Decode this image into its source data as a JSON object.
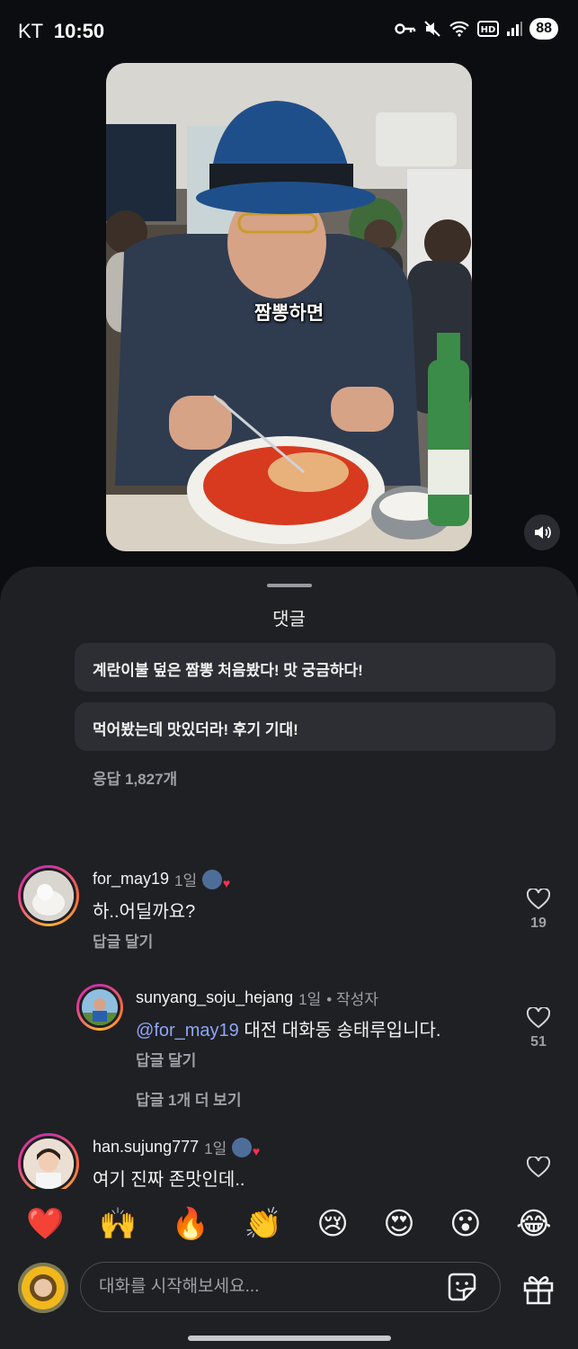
{
  "status_bar": {
    "carrier": "KT",
    "time": "10:50",
    "battery": "88"
  },
  "video": {
    "caption": "짬뽕하면"
  },
  "sheet": {
    "title": "댓글",
    "pinned_replies": [
      {
        "text": "계란이불 덮은 짬뽕 처음봤다! 맛 궁금하다!"
      },
      {
        "text": "먹어봤는데 맛있더라! 후기 기대!"
      }
    ],
    "replies_count": "응답 1,827개"
  },
  "comments": [
    {
      "username": "for_may19",
      "age": "1일",
      "text": "하..어딜까요?",
      "reply_label": "답글 달기",
      "likes": "19"
    },
    {
      "username": "sunyang_soju_hejang",
      "age": "1일",
      "author_tag": "• 작성자",
      "mention": "@for_may19",
      "text": " 대전 대화동 송태루입니다.",
      "reply_label": "답글 달기",
      "more_replies": "답글 1개 더 보기",
      "likes": "51"
    },
    {
      "username": "han.sujung777",
      "age": "1일",
      "text": "여기 진짜 존맛인데.."
    }
  ],
  "emoji_bar": [
    "❤️",
    "🙌",
    "🔥",
    "👏",
    "😢",
    "😍",
    "😮",
    "😂"
  ],
  "composer": {
    "placeholder": "대화를 시작해보세요..."
  },
  "colors": {
    "accent_mention": "#8fa6f5",
    "heart_red": "#ff2e4c",
    "sheet_bg": "#1f2024"
  }
}
